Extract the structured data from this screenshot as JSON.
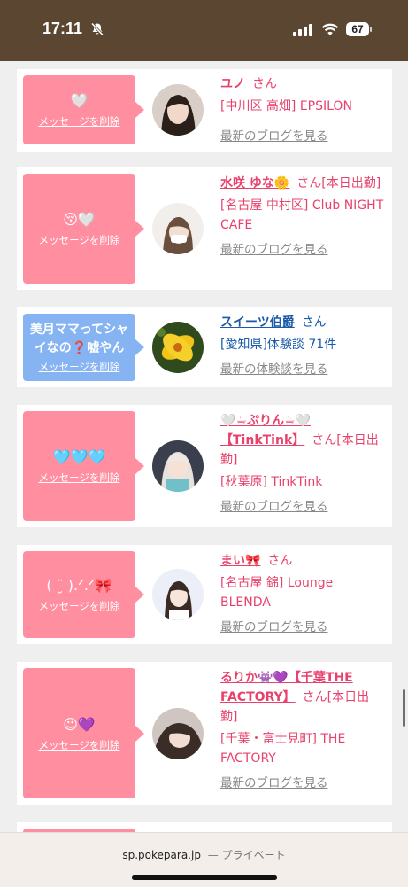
{
  "status": {
    "time": "17:11",
    "battery": "67"
  },
  "cards": [
    {
      "emoji": "🤍",
      "text": "",
      "delete": "メッセージを削除",
      "name": "ユノ",
      "san": "さん",
      "location": "[中川区 高畑] EPSILON",
      "link": "最新のブログを見る"
    },
    {
      "emoji": "😚🤍",
      "text": "",
      "delete": "メッセージを削除",
      "name": "水咲 ゆな🌼",
      "san": "さん[本日出勤]",
      "location": "[名古屋 中村区] Club NIGHT CAFE",
      "link": "最新のブログを見る"
    },
    {
      "emoji": "",
      "text": "美月ママってシャイなの❓嘘やん",
      "delete": "メッセージを削除",
      "name": "スイーツ伯爵",
      "san": "さん",
      "location": "[愛知県]体験談 71件",
      "link": "最新の体験談を見る"
    },
    {
      "emoji": "🩵🩵🩵",
      "text": "",
      "delete": "メッセージを削除",
      "name": "🤍☕ぷりん☕🤍【TinkTink】",
      "san": "さん[本日出勤]",
      "location": "[秋葉原] TinkTink",
      "link": "最新のブログを見る"
    },
    {
      "emoji": "( ¨̮ ).ᐟ.ᐟ🎀",
      "text": "",
      "delete": "メッセージを削除",
      "name": "まい🎀",
      "san": "さん",
      "location": "[名古屋 錦] Lounge BLENDA",
      "link": "最新のブログを見る"
    },
    {
      "emoji": "😉💜",
      "text": "",
      "delete": "メッセージを削除",
      "name": "るりか👾💜【千葉THE FACTORY】",
      "san": "さん[本日出勤]",
      "location": "[千葉・富士見町] THE FACTORY",
      "link": "最新のブログを見る"
    }
  ],
  "browser": {
    "domain": "sp.pokepara.jp",
    "mode": "— プライベート"
  }
}
